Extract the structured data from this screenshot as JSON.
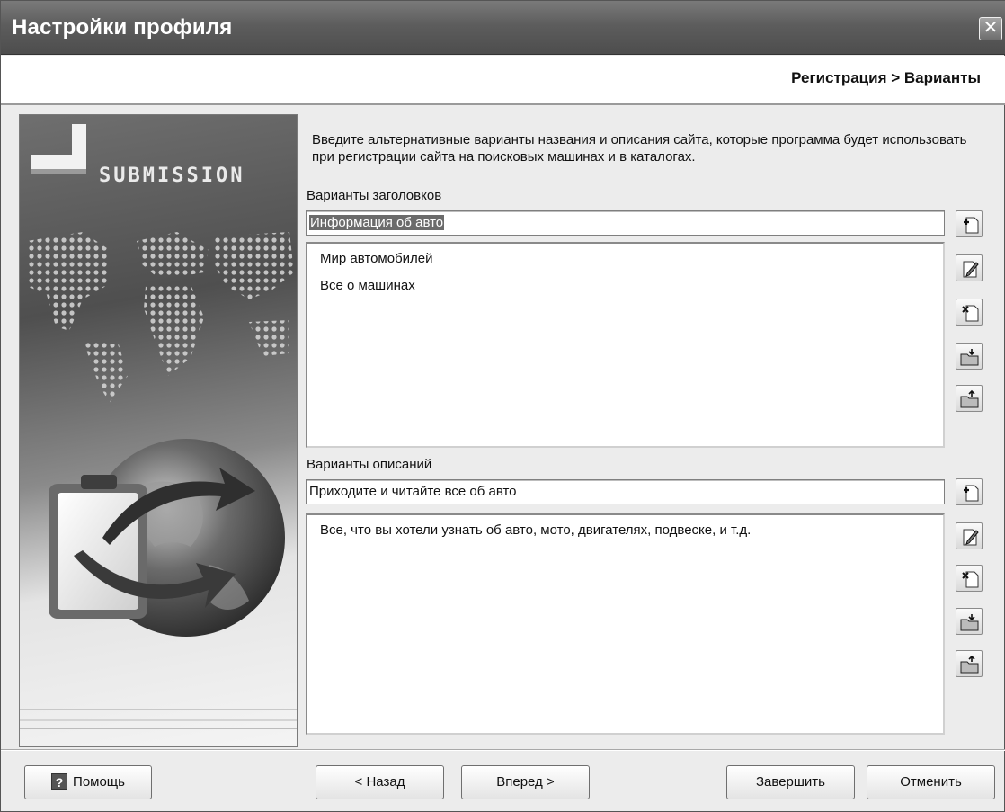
{
  "window": {
    "title": "Настройки профиля",
    "close_glyph": "✕"
  },
  "header": {
    "breadcrumb": "Регистрация > Варианты"
  },
  "banner": {
    "logo_text": "SUBMISSION"
  },
  "main": {
    "intro_text": "Введите альтернативные варианты названия и описания сайта, которые программа будет использовать при регистрации сайта на поисковых машинах и в каталогах.",
    "titles": {
      "label": "Варианты заголовков",
      "input_value": "Информация об авто",
      "items": [
        "Мир автомобилей",
        "Все о машинах"
      ]
    },
    "descriptions": {
      "label": "Варианты описаний",
      "input_value": "Приходите и читайте все об авто",
      "items": [
        "Все, что вы хотели узнать об авто, мото, двигателях, подвеске, и т.д."
      ]
    },
    "tool_buttons": [
      "add-icon",
      "edit-icon",
      "delete-icon",
      "import-icon",
      "export-icon"
    ]
  },
  "footer": {
    "help_icon": "?",
    "help_label": "Помощь",
    "back_label": "< Назад",
    "next_label": "Вперед >",
    "finish_label": "Завершить",
    "cancel_label": "Отменить"
  }
}
